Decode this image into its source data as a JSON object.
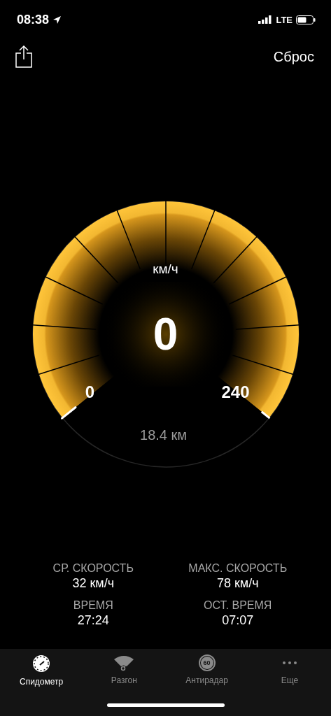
{
  "status_bar": {
    "time": "08:38",
    "network": "LTE"
  },
  "nav": {
    "action": "Сброс"
  },
  "gauge": {
    "unit": "км/ч",
    "speed": "0",
    "min": "0",
    "max": "240",
    "distance": "18.4 км"
  },
  "stats": [
    {
      "label": "СР. СКОРОСТЬ",
      "value": "32 км/ч"
    },
    {
      "label": "МАКС. СКОРОСТЬ",
      "value": "78 км/ч"
    },
    {
      "label": "ВРЕМЯ",
      "value": "27:24"
    },
    {
      "label": "ОСТ. ВРЕМЯ",
      "value": "07:07"
    }
  ],
  "tabs": [
    {
      "kind": "speedometer",
      "label": "Спидометр",
      "selected": true
    },
    {
      "kind": "acceleration",
      "label": "Разгон",
      "selected": false
    },
    {
      "kind": "radar",
      "label": "Антирадар",
      "badge": "60",
      "selected": false
    },
    {
      "kind": "more",
      "label": "Еще",
      "selected": false
    }
  ]
}
